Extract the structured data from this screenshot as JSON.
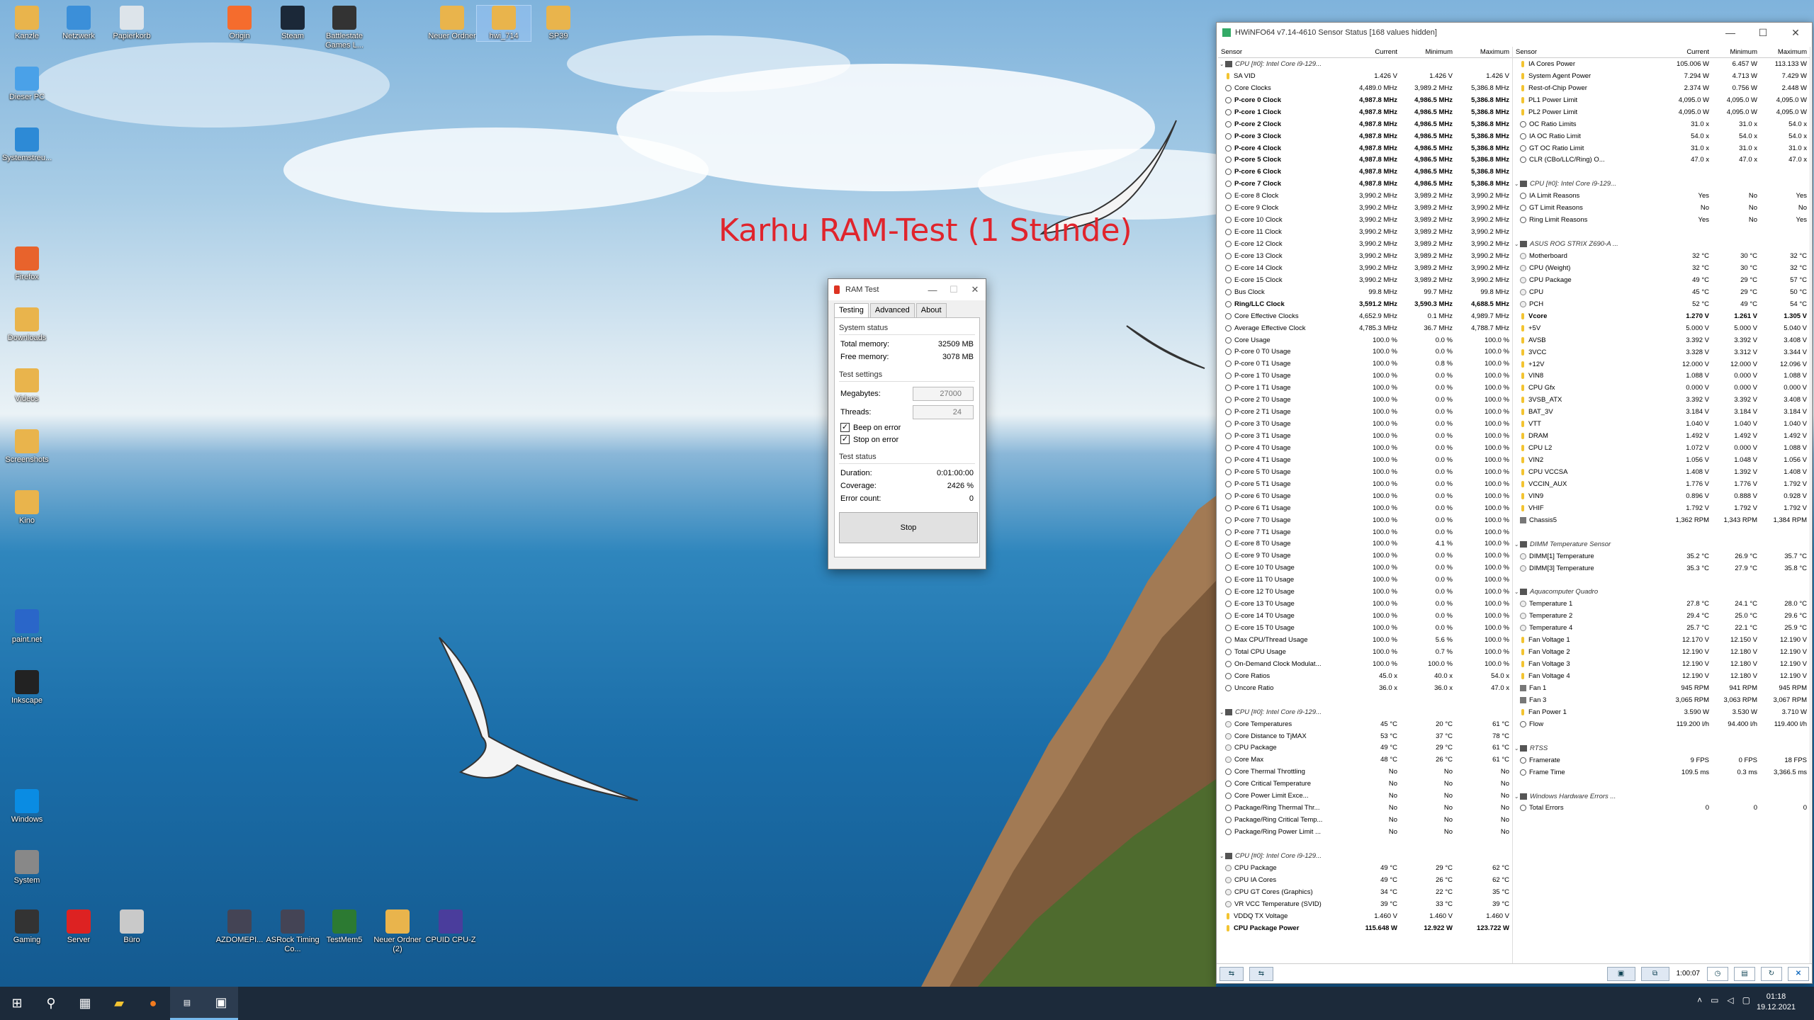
{
  "overlay_title": "Karhu RAM-Test (1 Stunde)",
  "desktop_icons": [
    {
      "id": "papierkorb-l",
      "label": "Kanzle",
      "icon": "folder"
    },
    {
      "id": "netzwerk",
      "label": "Netzwerk",
      "icon": "network"
    },
    {
      "id": "papierkorb",
      "label": "Papierkorb",
      "icon": "recycle-bin"
    },
    {
      "id": "origin",
      "label": "Origin",
      "icon": "origin"
    },
    {
      "id": "steam",
      "label": "Steam",
      "icon": "steam"
    },
    {
      "id": "battlestate",
      "label": "Battlestate Games L...",
      "icon": "game"
    },
    {
      "id": "neuer-ordner",
      "label": "Neuer Ordner",
      "icon": "folder"
    },
    {
      "id": "hwi",
      "label": "hwi_714",
      "icon": "folder"
    },
    {
      "id": "sp39",
      "label": "SP39",
      "icon": "folder"
    },
    {
      "id": "dieser-pc",
      "label": "Dieser PC",
      "icon": "pc"
    },
    {
      "id": "systemst",
      "label": "Systemstreu...",
      "icon": "settings"
    },
    {
      "id": "firefox",
      "label": "Firefox",
      "icon": "firefox"
    },
    {
      "id": "downloads",
      "label": "Downloads",
      "icon": "folder"
    },
    {
      "id": "videos",
      "label": "Videos",
      "icon": "folder"
    },
    {
      "id": "screenshots",
      "label": "Screenshots",
      "icon": "folder"
    },
    {
      "id": "kino",
      "label": "Kino",
      "icon": "folder"
    },
    {
      "id": "paintnet",
      "label": "paint.net",
      "icon": "paint"
    },
    {
      "id": "inkscape",
      "label": "Inkscape",
      "icon": "inkscape"
    },
    {
      "id": "windows",
      "label": "Windows",
      "icon": "windows"
    },
    {
      "id": "system",
      "label": "System",
      "icon": "gear"
    },
    {
      "id": "gaming",
      "label": "Gaming",
      "icon": "mouse"
    },
    {
      "id": "server",
      "label": "Server",
      "icon": "server"
    },
    {
      "id": "buro",
      "label": "Büro",
      "icon": "notepad"
    },
    {
      "id": "azdomepi",
      "label": "AZDOMEPI...",
      "icon": "app"
    },
    {
      "id": "asrock",
      "label": "ASRock Timing Co...",
      "icon": "app"
    },
    {
      "id": "testmem5",
      "label": "TestMem5",
      "icon": "ram"
    },
    {
      "id": "neuer-ordner-2",
      "label": "Neuer Ordner (2)",
      "icon": "folder"
    },
    {
      "id": "cpuz",
      "label": "CPUID CPU-Z",
      "icon": "cpu"
    }
  ],
  "ramtest": {
    "title": "RAM Test",
    "tabs": [
      "Testing",
      "Advanced",
      "About"
    ],
    "system_status": "System status",
    "total_memory_label": "Total memory:",
    "total_memory": "32509 MB",
    "free_memory_label": "Free memory:",
    "free_memory": "3078 MB",
    "test_settings": "Test settings",
    "megabytes_label": "Megabytes:",
    "megabytes": "27000",
    "threads_label": "Threads:",
    "threads": "24",
    "beep_label": "Beep on error",
    "stop_on_error_label": "Stop on error",
    "test_status": "Test status",
    "duration_label": "Duration:",
    "duration": "0:01:00:00",
    "coverage_label": "Coverage:",
    "coverage": "2426 %",
    "errors_label": "Error count:",
    "errors": "0",
    "stop_button": "Stop"
  },
  "hwinfo": {
    "title": "HWiNFO64 v7.14-4610 Sensor Status [168 values hidden]",
    "columns": [
      "Sensor",
      "Current",
      "Minimum",
      "Maximum"
    ],
    "left_rows": [
      [
        "g",
        "CPU [#0]: Intel Core i9-129...",
        "",
        "",
        ""
      ],
      [
        "y",
        "SA VID",
        "1.426 V",
        "1.426 V",
        "1.426 V"
      ],
      [
        "c",
        "Core Clocks",
        "4,489.0 MHz",
        "3,989.2 MHz",
        "5,386.8 MHz"
      ],
      [
        "bc",
        "P-core 0 Clock",
        "4,987.8 MHz",
        "4,986.5 MHz",
        "5,386.8 MHz"
      ],
      [
        "bc",
        "P-core 1 Clock",
        "4,987.8 MHz",
        "4,986.5 MHz",
        "5,386.8 MHz"
      ],
      [
        "bc",
        "P-core 2 Clock",
        "4,987.8 MHz",
        "4,986.5 MHz",
        "5,386.8 MHz"
      ],
      [
        "bc",
        "P-core 3 Clock",
        "4,987.8 MHz",
        "4,986.5 MHz",
        "5,386.8 MHz"
      ],
      [
        "bc",
        "P-core 4 Clock",
        "4,987.8 MHz",
        "4,986.5 MHz",
        "5,386.8 MHz"
      ],
      [
        "bc",
        "P-core 5 Clock",
        "4,987.8 MHz",
        "4,986.5 MHz",
        "5,386.8 MHz"
      ],
      [
        "bc",
        "P-core 6 Clock",
        "4,987.8 MHz",
        "4,986.5 MHz",
        "5,386.8 MHz"
      ],
      [
        "bc",
        "P-core 7 Clock",
        "4,987.8 MHz",
        "4,986.5 MHz",
        "5,386.8 MHz"
      ],
      [
        "c",
        "E-core 8 Clock",
        "3,990.2 MHz",
        "3,989.2 MHz",
        "3,990.2 MHz"
      ],
      [
        "c",
        "E-core 9 Clock",
        "3,990.2 MHz",
        "3,989.2 MHz",
        "3,990.2 MHz"
      ],
      [
        "c",
        "E-core 10 Clock",
        "3,990.2 MHz",
        "3,989.2 MHz",
        "3,990.2 MHz"
      ],
      [
        "c",
        "E-core 11 Clock",
        "3,990.2 MHz",
        "3,989.2 MHz",
        "3,990.2 MHz"
      ],
      [
        "c",
        "E-core 12 Clock",
        "3,990.2 MHz",
        "3,989.2 MHz",
        "3,990.2 MHz"
      ],
      [
        "c",
        "E-core 13 Clock",
        "3,990.2 MHz",
        "3,989.2 MHz",
        "3,990.2 MHz"
      ],
      [
        "c",
        "E-core 14 Clock",
        "3,990.2 MHz",
        "3,989.2 MHz",
        "3,990.2 MHz"
      ],
      [
        "c",
        "E-core 15 Clock",
        "3,990.2 MHz",
        "3,989.2 MHz",
        "3,990.2 MHz"
      ],
      [
        "c",
        "Bus Clock",
        "99.8 MHz",
        "99.7 MHz",
        "99.8 MHz"
      ],
      [
        "bc",
        "Ring/LLC Clock",
        "3,591.2 MHz",
        "3,590.3 MHz",
        "4,688.5 MHz"
      ],
      [
        "c",
        "Core Effective Clocks",
        "4,652.9 MHz",
        "0.1 MHz",
        "4,989.7 MHz"
      ],
      [
        "c",
        "Average Effective Clock",
        "4,785.3 MHz",
        "36.7 MHz",
        "4,788.7 MHz"
      ],
      [
        "c",
        "Core Usage",
        "100.0 %",
        "0.0 %",
        "100.0 %"
      ],
      [
        "c",
        "P-core 0 T0 Usage",
        "100.0 %",
        "0.0 %",
        "100.0 %"
      ],
      [
        "c",
        "P-core 0 T1 Usage",
        "100.0 %",
        "0.8 %",
        "100.0 %"
      ],
      [
        "c",
        "P-core 1 T0 Usage",
        "100.0 %",
        "0.0 %",
        "100.0 %"
      ],
      [
        "c",
        "P-core 1 T1 Usage",
        "100.0 %",
        "0.0 %",
        "100.0 %"
      ],
      [
        "c",
        "P-core 2 T0 Usage",
        "100.0 %",
        "0.0 %",
        "100.0 %"
      ],
      [
        "c",
        "P-core 2 T1 Usage",
        "100.0 %",
        "0.0 %",
        "100.0 %"
      ],
      [
        "c",
        "P-core 3 T0 Usage",
        "100.0 %",
        "0.0 %",
        "100.0 %"
      ],
      [
        "c",
        "P-core 3 T1 Usage",
        "100.0 %",
        "0.0 %",
        "100.0 %"
      ],
      [
        "c",
        "P-core 4 T0 Usage",
        "100.0 %",
        "0.0 %",
        "100.0 %"
      ],
      [
        "c",
        "P-core 4 T1 Usage",
        "100.0 %",
        "0.0 %",
        "100.0 %"
      ],
      [
        "c",
        "P-core 5 T0 Usage",
        "100.0 %",
        "0.0 %",
        "100.0 %"
      ],
      [
        "c",
        "P-core 5 T1 Usage",
        "100.0 %",
        "0.0 %",
        "100.0 %"
      ],
      [
        "c",
        "P-core 6 T0 Usage",
        "100.0 %",
        "0.0 %",
        "100.0 %"
      ],
      [
        "c",
        "P-core 6 T1 Usage",
        "100.0 %",
        "0.0 %",
        "100.0 %"
      ],
      [
        "c",
        "P-core 7 T0 Usage",
        "100.0 %",
        "0.0 %",
        "100.0 %"
      ],
      [
        "c",
        "P-core 7 T1 Usage",
        "100.0 %",
        "0.0 %",
        "100.0 %"
      ],
      [
        "c",
        "E-core 8 T0 Usage",
        "100.0 %",
        "4.1 %",
        "100.0 %"
      ],
      [
        "c",
        "E-core 9 T0 Usage",
        "100.0 %",
        "0.0 %",
        "100.0 %"
      ],
      [
        "c",
        "E-core 10 T0 Usage",
        "100.0 %",
        "0.0 %",
        "100.0 %"
      ],
      [
        "c",
        "E-core 11 T0 Usage",
        "100.0 %",
        "0.0 %",
        "100.0 %"
      ],
      [
        "c",
        "E-core 12 T0 Usage",
        "100.0 %",
        "0.0 %",
        "100.0 %"
      ],
      [
        "c",
        "E-core 13 T0 Usage",
        "100.0 %",
        "0.0 %",
        "100.0 %"
      ],
      [
        "c",
        "E-core 14 T0 Usage",
        "100.0 %",
        "0.0 %",
        "100.0 %"
      ],
      [
        "c",
        "E-core 15 T0 Usage",
        "100.0 %",
        "0.0 %",
        "100.0 %"
      ],
      [
        "c",
        "Max CPU/Thread Usage",
        "100.0 %",
        "5.6 %",
        "100.0 %"
      ],
      [
        "c",
        "Total CPU Usage",
        "100.0 %",
        "0.7 %",
        "100.0 %"
      ],
      [
        "c",
        "On-Demand Clock Modulat...",
        "100.0 %",
        "100.0 %",
        "100.0 %"
      ],
      [
        "c",
        "Core Ratios",
        "45.0 x",
        "40.0 x",
        "54.0 x"
      ],
      [
        "c",
        "Uncore Ratio",
        "36.0 x",
        "36.0 x",
        "47.0 x"
      ],
      [
        "s",
        "",
        "",
        "",
        ""
      ],
      [
        "g",
        "CPU [#0]: Intel Core i9-129...",
        "",
        "",
        ""
      ],
      [
        "t",
        "Core Temperatures",
        "45 °C",
        "20 °C",
        "61 °C"
      ],
      [
        "t",
        "Core Distance to TjMAX",
        "53 °C",
        "37 °C",
        "78 °C"
      ],
      [
        "t",
        "CPU Package",
        "49 °C",
        "29 °C",
        "61 °C"
      ],
      [
        "t",
        "Core Max",
        "48 °C",
        "26 °C",
        "61 °C"
      ],
      [
        "c",
        "Core Thermal Throttling",
        "No",
        "No",
        "No"
      ],
      [
        "c",
        "Core Critical Temperature",
        "No",
        "No",
        "No"
      ],
      [
        "c",
        "Core Power Limit Exce...",
        "No",
        "No",
        "No"
      ],
      [
        "c",
        "Package/Ring Thermal Thr...",
        "No",
        "No",
        "No"
      ],
      [
        "c",
        "Package/Ring Critical Temp...",
        "No",
        "No",
        "No"
      ],
      [
        "c",
        "Package/Ring Power Limit ...",
        "No",
        "No",
        "No"
      ],
      [
        "s",
        "",
        "",
        "",
        ""
      ],
      [
        "g",
        "CPU [#0]: Intel Core i9-129...",
        "",
        "",
        ""
      ],
      [
        "t",
        "CPU Package",
        "49 °C",
        "29 °C",
        "62 °C"
      ],
      [
        "t",
        "CPU IA Cores",
        "49 °C",
        "26 °C",
        "62 °C"
      ],
      [
        "t",
        "CPU GT Cores (Graphics)",
        "34 °C",
        "22 °C",
        "35 °C"
      ],
      [
        "t",
        "VR VCC Temperature (SVID)",
        "39 °C",
        "33 °C",
        "39 °C"
      ],
      [
        "y",
        "VDDQ TX Voltage",
        "1.460 V",
        "1.460 V",
        "1.460 V"
      ],
      [
        "by",
        "CPU Package Power",
        "115.648 W",
        "12.922 W",
        "123.722 W"
      ]
    ],
    "right_rows": [
      [
        "y",
        "IA Cores Power",
        "105.006 W",
        "6.457 W",
        "113.133 W"
      ],
      [
        "y",
        "System Agent Power",
        "7.294 W",
        "4.713 W",
        "7.429 W"
      ],
      [
        "y",
        "Rest-of-Chip Power",
        "2.374 W",
        "0.756 W",
        "2.448 W"
      ],
      [
        "y",
        "PL1 Power Limit",
        "4,095.0 W",
        "4,095.0 W",
        "4,095.0 W"
      ],
      [
        "y",
        "PL2 Power Limit",
        "4,095.0 W",
        "4,095.0 W",
        "4,095.0 W"
      ],
      [
        "c",
        "OC Ratio Limits",
        "31.0 x",
        "31.0 x",
        "54.0 x"
      ],
      [
        "c",
        "IA OC Ratio Limit",
        "54.0 x",
        "54.0 x",
        "54.0 x"
      ],
      [
        "c",
        "GT OC Ratio Limit",
        "31.0 x",
        "31.0 x",
        "31.0 x"
      ],
      [
        "c",
        "CLR (CBo/LLC/Ring) O...",
        "47.0 x",
        "47.0 x",
        "47.0 x"
      ],
      [
        "s",
        "",
        "",
        "",
        ""
      ],
      [
        "g",
        "CPU [#0]: Intel Core i9-129...",
        "",
        "",
        ""
      ],
      [
        "c",
        "IA Limit Reasons",
        "Yes",
        "No",
        "Yes"
      ],
      [
        "c",
        "GT Limit Reasons",
        "No",
        "No",
        "No"
      ],
      [
        "c",
        "Ring Limit Reasons",
        "Yes",
        "No",
        "Yes"
      ],
      [
        "s",
        "",
        "",
        "",
        ""
      ],
      [
        "g",
        "ASUS ROG STRIX Z690-A ...",
        "",
        "",
        ""
      ],
      [
        "t",
        "Motherboard",
        "32 °C",
        "30 °C",
        "32 °C"
      ],
      [
        "t",
        "CPU (Weight)",
        "32 °C",
        "30 °C",
        "32 °C"
      ],
      [
        "t",
        "CPU Package",
        "49 °C",
        "29 °C",
        "57 °C"
      ],
      [
        "t",
        "CPU",
        "45 °C",
        "29 °C",
        "50 °C"
      ],
      [
        "t",
        "PCH",
        "52 °C",
        "49 °C",
        "54 °C"
      ],
      [
        "by",
        "Vcore",
        "1.270 V",
        "1.261 V",
        "1.305 V"
      ],
      [
        "y",
        "+5V",
        "5.000 V",
        "5.000 V",
        "5.040 V"
      ],
      [
        "y",
        "AVSB",
        "3.392 V",
        "3.392 V",
        "3.408 V"
      ],
      [
        "y",
        "3VCC",
        "3.328 V",
        "3.312 V",
        "3.344 V"
      ],
      [
        "y",
        "+12V",
        "12.000 V",
        "12.000 V",
        "12.096 V"
      ],
      [
        "y",
        "VIN8",
        "1.088 V",
        "0.000 V",
        "1.088 V"
      ],
      [
        "y",
        "CPU Gfx",
        "0.000 V",
        "0.000 V",
        "0.000 V"
      ],
      [
        "y",
        "3VSB_ATX",
        "3.392 V",
        "3.392 V",
        "3.408 V"
      ],
      [
        "y",
        "BAT_3V",
        "3.184 V",
        "3.184 V",
        "3.184 V"
      ],
      [
        "y",
        "VTT",
        "1.040 V",
        "1.040 V",
        "1.040 V"
      ],
      [
        "y",
        "DRAM",
        "1.492 V",
        "1.492 V",
        "1.492 V"
      ],
      [
        "y",
        "CPU L2",
        "1.072 V",
        "0.000 V",
        "1.088 V"
      ],
      [
        "y",
        "VIN2",
        "1.056 V",
        "1.048 V",
        "1.056 V"
      ],
      [
        "y",
        "CPU VCCSA",
        "1.408 V",
        "1.392 V",
        "1.408 V"
      ],
      [
        "y",
        "VCCIN_AUX",
        "1.776 V",
        "1.776 V",
        "1.792 V"
      ],
      [
        "y",
        "VIN9",
        "0.896 V",
        "0.888 V",
        "0.928 V"
      ],
      [
        "y",
        "VHIF",
        "1.792 V",
        "1.792 V",
        "1.792 V"
      ],
      [
        "d",
        "Chassis5",
        "1,362 RPM",
        "1,343 RPM",
        "1,384 RPM"
      ],
      [
        "s",
        "",
        "",
        "",
        ""
      ],
      [
        "g",
        "DIMM Temperature Sensor",
        "",
        "",
        ""
      ],
      [
        "t",
        "DIMM[1] Temperature",
        "35.2 °C",
        "26.9 °C",
        "35.7 °C"
      ],
      [
        "t",
        "DIMM[3] Temperature",
        "35.3 °C",
        "27.9 °C",
        "35.8 °C"
      ],
      [
        "s",
        "",
        "",
        "",
        ""
      ],
      [
        "g",
        "Aquacomputer Quadro",
        "",
        "",
        ""
      ],
      [
        "t",
        "Temperature 1",
        "27.8 °C",
        "24.1 °C",
        "28.0 °C"
      ],
      [
        "t",
        "Temperature 2",
        "29.4 °C",
        "25.0 °C",
        "29.6 °C"
      ],
      [
        "t",
        "Temperature 4",
        "25.7 °C",
        "22.1 °C",
        "25.9 °C"
      ],
      [
        "y",
        "Fan Voltage 1",
        "12.170 V",
        "12.150 V",
        "12.190 V"
      ],
      [
        "y",
        "Fan Voltage 2",
        "12.190 V",
        "12.180 V",
        "12.190 V"
      ],
      [
        "y",
        "Fan Voltage 3",
        "12.190 V",
        "12.180 V",
        "12.190 V"
      ],
      [
        "y",
        "Fan Voltage 4",
        "12.190 V",
        "12.180 V",
        "12.190 V"
      ],
      [
        "d",
        "Fan 1",
        "945 RPM",
        "941 RPM",
        "945 RPM"
      ],
      [
        "d",
        "Fan 3",
        "3,065 RPM",
        "3,063 RPM",
        "3,067 RPM"
      ],
      [
        "y",
        "Fan Power 1",
        "3.590 W",
        "3.530 W",
        "3.710 W"
      ],
      [
        "c",
        "Flow",
        "119.200 l/h",
        "94.400 l/h",
        "119.400 l/h"
      ],
      [
        "s",
        "",
        "",
        "",
        ""
      ],
      [
        "g",
        "RTSS",
        "",
        "",
        ""
      ],
      [
        "c",
        "Framerate",
        "9 FPS",
        "0 FPS",
        "18 FPS"
      ],
      [
        "c",
        "Frame Time",
        "109.5 ms",
        "0.3 ms",
        "3,366.5 ms"
      ],
      [
        "s",
        "",
        "",
        "",
        ""
      ],
      [
        "g",
        "Windows Hardware Errors ...",
        "",
        "",
        ""
      ],
      [
        "c",
        "Total Errors",
        "0",
        "0",
        "0"
      ]
    ],
    "timer": "1:00:07"
  },
  "taskbar": {
    "time": "01:18",
    "date": "19.12.2021"
  }
}
